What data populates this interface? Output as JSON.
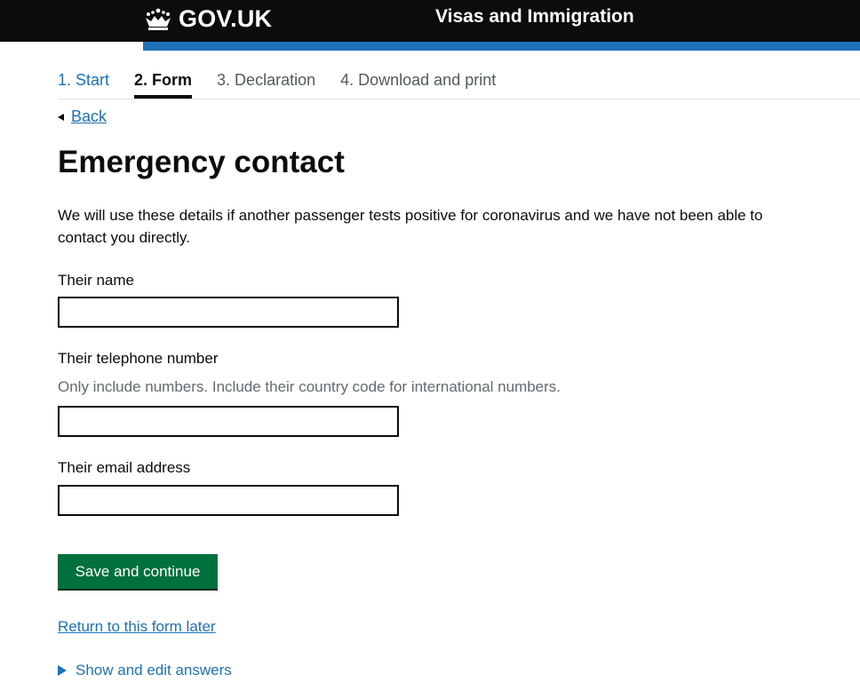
{
  "header": {
    "logo_text": "GOV.UK",
    "service_name": "Visas and Immigration",
    "crown_icon": "crown-icon",
    "colors": {
      "header_bg": "#0b0c0c",
      "accent_bar": "#1d70b8"
    }
  },
  "steps": [
    {
      "label": "1. Start",
      "state": "link"
    },
    {
      "label": "2. Form",
      "state": "active"
    },
    {
      "label": "3. Declaration",
      "state": "inactive"
    },
    {
      "label": "4. Download and print",
      "state": "inactive"
    }
  ],
  "back": {
    "label": "Back"
  },
  "page": {
    "title": "Emergency contact",
    "intro": "We will use these details if another passenger tests positive for coronavirus and we have not been able to contact you directly."
  },
  "fields": {
    "name": {
      "label": "Their name",
      "value": ""
    },
    "phone": {
      "label": "Their telephone number",
      "hint": "Only include numbers. Include their country code for international numbers.",
      "value": ""
    },
    "email": {
      "label": "Their email address",
      "value": ""
    }
  },
  "actions": {
    "save_label": "Save and continue",
    "return_label": "Return to this form later",
    "show_answers_label": "Show and edit answers"
  },
  "colors": {
    "link": "#1d70b8",
    "button": "#00703c",
    "text": "#0b0c0c",
    "hint": "#626a6e"
  }
}
